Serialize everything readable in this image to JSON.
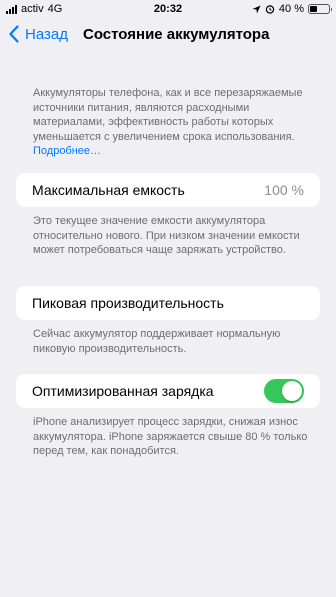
{
  "status_bar": {
    "carrier": "activ",
    "network": "4G",
    "time": "20:32",
    "battery_percent": "40 %",
    "battery_level": 0.4
  },
  "nav": {
    "back_label": "Назад",
    "title": "Состояние аккумулятора"
  },
  "intro": {
    "text": "Аккумуляторы телефона, как и все перезаряжаемые источники питания, являются расходными материалами, эффективность работы которых уменьшается с увеличением срока использования.",
    "link": "Подробнее…"
  },
  "max_capacity": {
    "label": "Максимальная емкость",
    "value": "100 %",
    "footnote": "Это текущее значение емкости аккумулятора относительно нового. При низком значении емкости может потребоваться чаще заряжать устройство."
  },
  "peak_performance": {
    "label": "Пиковая производительность",
    "footnote": "Сейчас аккумулятор поддерживает нормальную пиковую производительность."
  },
  "optimized_charging": {
    "label": "Оптимизированная зарядка",
    "enabled": true,
    "footnote": "iPhone анализирует процесс зарядки, снижая износ аккумулятора. iPhone заряжается свыше 80 % только перед тем, как понадобится."
  },
  "colors": {
    "accent": "#007aff",
    "toggle_on": "#34c759",
    "background": "#efeff4"
  }
}
